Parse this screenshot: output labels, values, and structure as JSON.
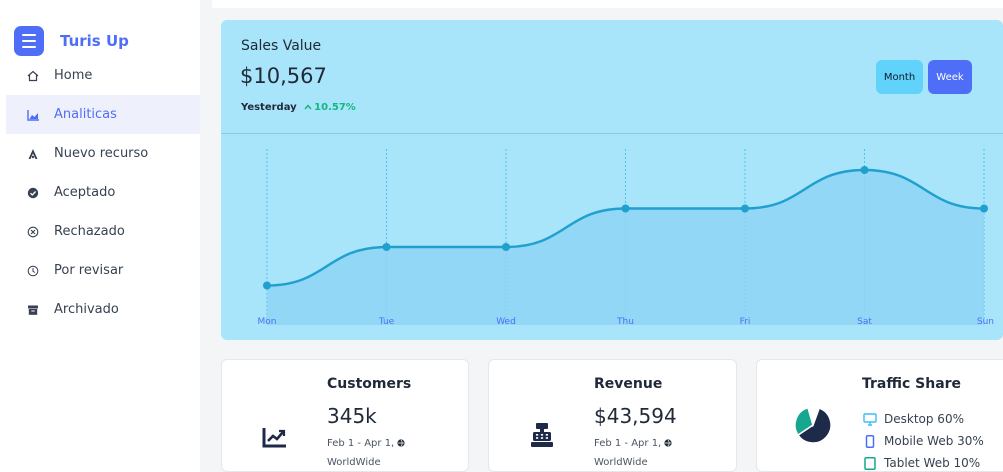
{
  "brand": {
    "name": "Turis Up"
  },
  "sidebar": {
    "items": [
      {
        "label": "Home",
        "icon": "home-icon"
      },
      {
        "label": "Analiticas",
        "icon": "chart-icon"
      },
      {
        "label": "Nuevo recurso",
        "icon": "resource-icon"
      },
      {
        "label": "Aceptado",
        "icon": "check-circle-icon"
      },
      {
        "label": "Rechazado",
        "icon": "x-circle-icon"
      },
      {
        "label": "Por revisar",
        "icon": "clock-icon"
      },
      {
        "label": "Archivado",
        "icon": "archive-icon"
      }
    ],
    "active_index": 1
  },
  "sales": {
    "title": "Sales Value",
    "value": "$10,567",
    "period": "Yesterday",
    "delta": "10.57%",
    "buttons": {
      "month": "Month",
      "week": "Week"
    }
  },
  "chart_data": {
    "type": "area",
    "categories": [
      "Mon",
      "Tue",
      "Wed",
      "Thu",
      "Fri",
      "Sat",
      "Sun"
    ],
    "series": [
      {
        "values": [
          1,
          2,
          2,
          3,
          3,
          4,
          3
        ]
      }
    ],
    "title": "",
    "xlabel": "",
    "ylabel": "",
    "grid": true
  },
  "cards": {
    "customers": {
      "title": "Customers",
      "value": "345k",
      "date": "Feb 1 - Apr 1,",
      "region": "WorldWide"
    },
    "revenue": {
      "title": "Revenue",
      "value": "$43,594",
      "date": "Feb 1 - Apr 1,",
      "region": "WorldWide"
    },
    "traffic": {
      "title": "Traffic Share",
      "items": [
        {
          "label": "Desktop 60%",
          "value": 60,
          "icon": "desktop-icon"
        },
        {
          "label": "Mobile Web 30%",
          "value": 30,
          "icon": "mobile-icon"
        },
        {
          "label": "Tablet Web 10%",
          "value": 10,
          "icon": "tablet-icon"
        }
      ]
    }
  },
  "colors": {
    "accent": "#4f6ef7",
    "chart_bg": "#a8e4fa",
    "line": "#1fa0cf",
    "positive": "#10b981",
    "pie_desktop": "#1e2a4a",
    "pie_mobile": "#17a68f"
  }
}
